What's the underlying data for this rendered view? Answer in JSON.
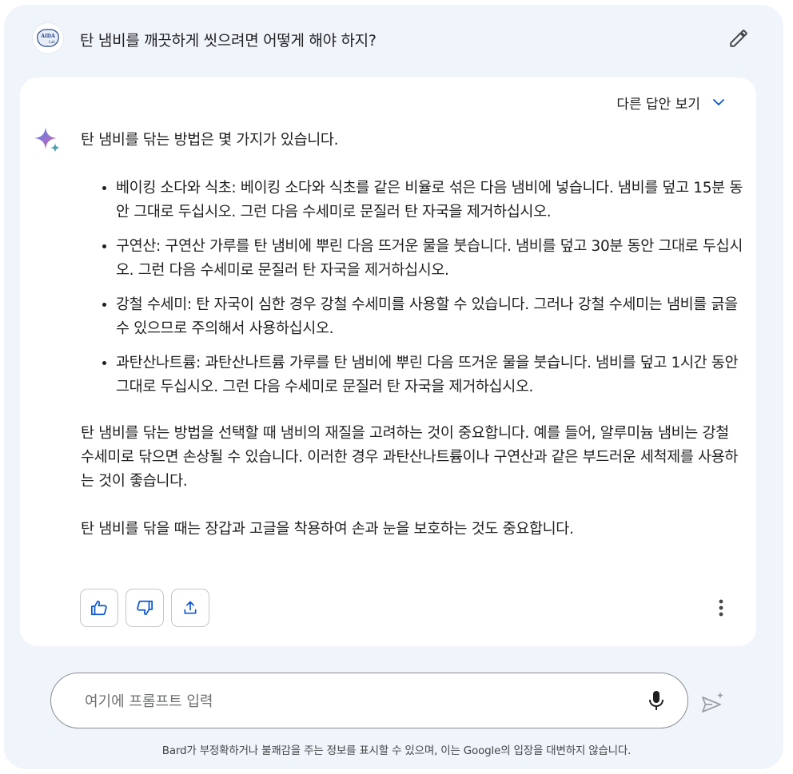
{
  "prompt": {
    "text": "탄 냄비를 깨끗하게 씻으려면 어떻게 해야 하지?",
    "avatar_label": "AIDA Lab",
    "edit_icon": "pencil-icon"
  },
  "response": {
    "other_answers_label": "다른 답안 보기",
    "intro": "탄 냄비를 닦는 방법은 몇 가지가 있습니다.",
    "methods": [
      {
        "text": "베이킹 소다와 식초: 베이킹 소다와 식초를 같은 비율로 섞은 다음 냄비에 넣습니다. 냄비를 덮고 15분 동안 그대로 두십시오. 그런 다음 수세미로 문질러 탄 자국을 제거하십시오."
      },
      {
        "text": "구연산: 구연산 가루를 탄 냄비에 뿌린 다음 뜨거운 물을 붓습니다. 냄비를 덮고 30분 동안 그대로 두십시오. 그런 다음 수세미로 문질러 탄 자국을 제거하십시오."
      },
      {
        "text": "강철 수세미: 탄 자국이 심한 경우 강철 수세미를 사용할 수 있습니다. 그러나 강철 수세미는 냄비를 긁을 수 있으므로 주의해서 사용하십시오."
      },
      {
        "text": "과탄산나트륨: 과탄산나트륨 가루를 탄 냄비에 뿌린 다음 뜨거운 물을 붓습니다. 냄비를 덮고 1시간 동안 그대로 두십시오. 그런 다음 수세미로 문질러 탄 자국을 제거하십시오."
      }
    ],
    "paragraph_material": "탄 냄비를 닦는 방법을 선택할 때 냄비의 재질을 고려하는 것이 중요합니다. 예를 들어, 알루미늄 냄비는 강철 수세미로 닦으면 손상될 수 있습니다. 이러한 경우 과탄산나트륨이나 구연산과 같은 부드러운 세척제를 사용하는 것이 좋습니다.",
    "paragraph_safety": "탄 냄비를 닦을 때는 장갑과 고글을 착용하여 손과 눈을 보호하는 것도 중요합니다."
  },
  "input": {
    "placeholder": "여기에 프롬프트 입력",
    "value": ""
  },
  "disclaimer": "Bard가 부정확하거나 불쾌감을 주는 정보를 표시할 수 있으며, 이는 Google의 입장을 대변하지 않습니다.",
  "colors": {
    "frame_bg": "#f0f4fb",
    "accent_blue": "#0b57d0",
    "icon_dark": "#444746",
    "spark_blue": "#4285f4",
    "spark_purple": "#9b72cb"
  }
}
